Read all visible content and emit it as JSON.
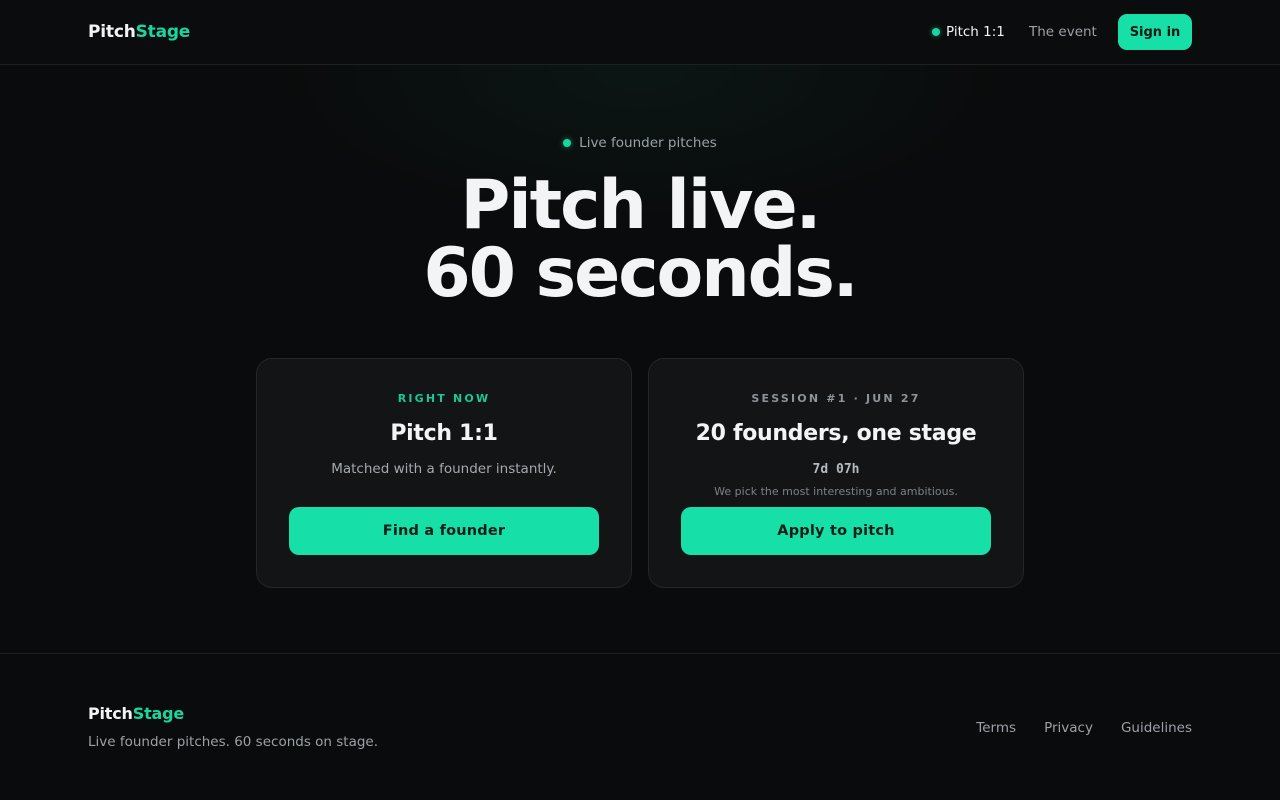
{
  "brand": {
    "part1": "Pitch",
    "part2": "Stage"
  },
  "nav": {
    "live_label": "Pitch 1:1",
    "event_label": "The event",
    "signin_label": "Sign in"
  },
  "hero": {
    "eyebrow": "Live founder pitches",
    "headline_line1": "Pitch live.",
    "headline_line2": "60 seconds."
  },
  "cards": [
    {
      "kicker": "RIGHT NOW",
      "title": "Pitch 1:1",
      "subtitle": "Matched with a founder instantly.",
      "cta": "Find a founder"
    },
    {
      "kicker": "SESSION #1 · JUN 27",
      "title": "20 founders, one stage",
      "countdown": "7d 07h",
      "note": "We pick the most interesting and ambitious.",
      "cta": "Apply to pitch"
    }
  ],
  "footer": {
    "tagline": "Live founder pitches. 60 seconds on stage.",
    "links": [
      "Terms",
      "Privacy",
      "Guidelines"
    ]
  },
  "colors": {
    "accent": "#16e0a8",
    "background": "#0a0b0c",
    "card": "#121416"
  },
  "icons": {
    "live_indicator": "green-dot-icon"
  }
}
